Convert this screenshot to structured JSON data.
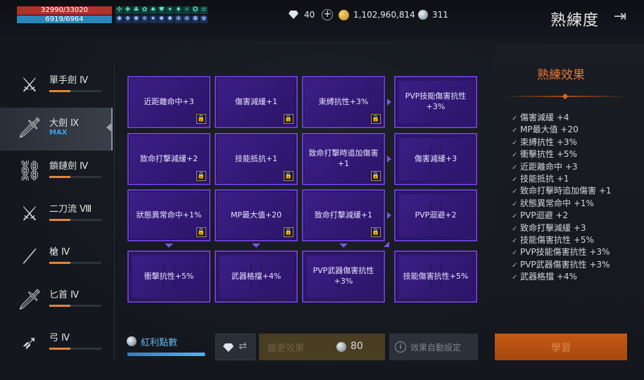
{
  "status": {
    "hp_text": "32990/33020",
    "mp_text": "6919/6964"
  },
  "buff_icons_row1": [
    "✣",
    "✚",
    "♣",
    "✿",
    "♠",
    "♥",
    "✦",
    "♦",
    "✧",
    "✪",
    "✫"
  ],
  "buff_icons_row2": [
    "✱",
    "❖",
    "✺",
    "✵",
    "✷",
    "✸",
    "✹",
    "✻",
    "✼",
    "✽",
    "✾"
  ],
  "currency": {
    "diamonds": "40",
    "gold": "1,102,960,814",
    "orbs": "311"
  },
  "header": {
    "title": "熟練度",
    "exit_icon": "exit-icon"
  },
  "weapons": [
    {
      "name": "單手劍 Ⅳ",
      "icon": "one-hand-sword-icon",
      "glyph": "⚔",
      "progress": 0.4,
      "max": ""
    },
    {
      "name": "大劍 Ⅸ",
      "icon": "greatsword-icon",
      "glyph": "🗡",
      "progress": 1.0,
      "max": "MAX"
    },
    {
      "name": "鎖鏈劍 Ⅳ",
      "icon": "chain-sword-icon",
      "glyph": "⛓",
      "progress": 0.4,
      "max": ""
    },
    {
      "name": "二刀流 Ⅷ",
      "icon": "dual-blades-icon",
      "glyph": "⚔",
      "progress": 0.4,
      "max": ""
    },
    {
      "name": "槍 Ⅳ",
      "icon": "spear-icon",
      "glyph": "⟋",
      "progress": 0.4,
      "max": ""
    },
    {
      "name": "匕首 Ⅳ",
      "icon": "dagger-icon",
      "glyph": "🗡",
      "progress": 0.4,
      "max": ""
    },
    {
      "name": "弓 Ⅳ",
      "icon": "bow-icon",
      "glyph": "➶",
      "progress": 0.4,
      "max": ""
    }
  ],
  "grid": {
    "rows": [
      [
        "近距離命中+3",
        "傷害減緩+1",
        "束縛抗性+3%",
        "PVP技能傷害抗性+3%"
      ],
      [
        "致命打擊減緩+2",
        "技能抵抗+1",
        "致命打擊時追加傷害+1",
        "傷害減緩+3"
      ],
      [
        "狀態異常命中+1%",
        "MP最大值+20",
        "致命打擊減緩+1",
        "PVP迴避+2"
      ],
      [
        "衝擊抗性+5%",
        "武器格擋+4%",
        "PVP武器傷害抗性+3%",
        "技能傷害抗性+5%"
      ]
    ]
  },
  "effects": {
    "title": "熟練效果",
    "items": [
      "傷害減緩 +4",
      "MP最大值 +20",
      "束縛抗性 +3%",
      "衝擊抗性 +5%",
      "近距離命中 +3",
      "技能抵抗 +1",
      "致命打擊時追加傷害 +1",
      "狀態異常命中 +1%",
      "PVP迴避 +2",
      "致命打擊減緩 +3",
      "技能傷害抗性 +5%",
      "PVP技能傷害抗性 +3%",
      "PVP武器傷害抗性 +3%",
      "武器格擋 +4%"
    ]
  },
  "bottom": {
    "bonus_label": "紅利點數",
    "bonus_progress": 0.98,
    "change_label": "變更效果",
    "change_cost": "80",
    "auto_label": "效果自動設定",
    "learn_label": "學習"
  },
  "colors": {
    "accent": "#e7772c",
    "tile": "#3c1f86",
    "tile_border": "#6a3bd6",
    "bonus": "#66b8ee"
  }
}
